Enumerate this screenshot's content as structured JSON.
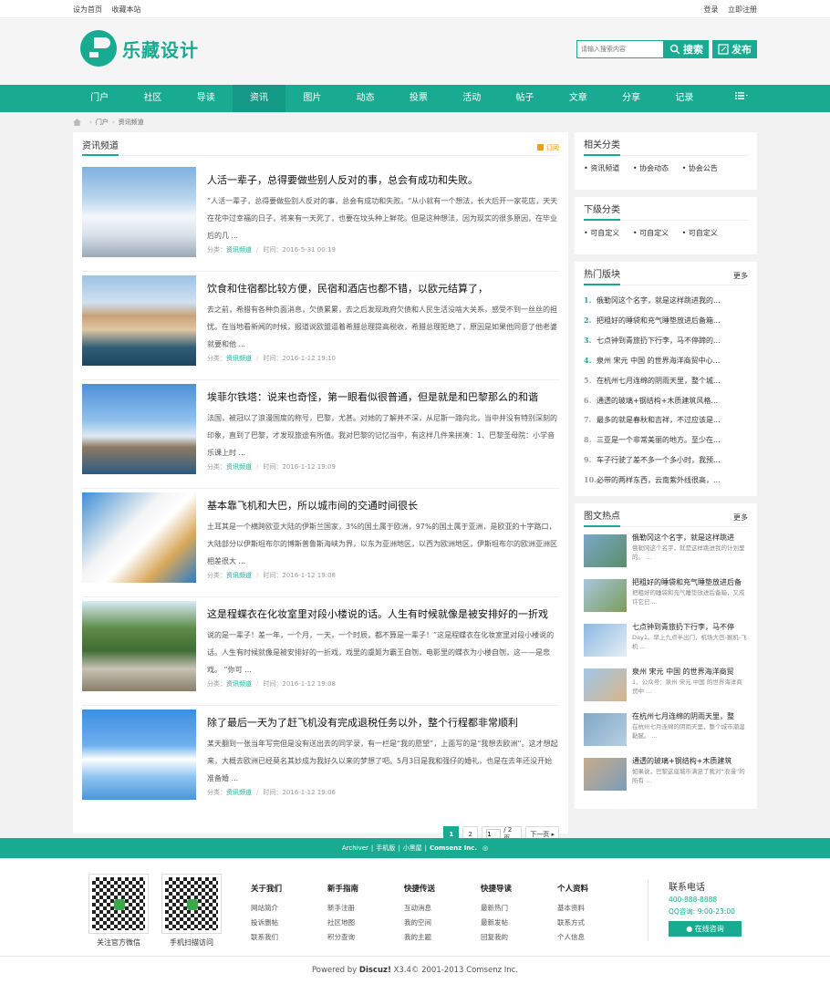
{
  "topbar": {
    "set_home": "设为首页",
    "bookmark": "收藏本站",
    "login": "登录",
    "register": "立即注册"
  },
  "header": {
    "logo_text": "乐藏设计",
    "search_placeholder": "请输入搜索内容",
    "search_button": "搜索",
    "post_button": "发布"
  },
  "nav": {
    "items": [
      "门户",
      "社区",
      "导读",
      "资讯",
      "图片",
      "动态",
      "投票",
      "活动",
      "帖子",
      "文章",
      "分享",
      "记录"
    ],
    "active": "资讯",
    "menu_icon": "list-icon"
  },
  "breadcrumb": {
    "home": "门户",
    "current": "资讯频道"
  },
  "main": {
    "title": "资讯频道",
    "rss": "订阅",
    "category_label": "分类：",
    "time_label": "时间：",
    "articles": [
      {
        "title": "人活一辈子，总得要做些别人反对的事，总会有成功和失败。",
        "summary": "“人活一辈子，总得要做些别人反对的事，总会有成功和失败。“从小就有一个想法，长大后开一家花店，天天在花中过幸福的日子，将来有一天死了，也要在坟头种上鲜花。但是这种想法，因为现实的很多原因，在毕业后的几 ...",
        "category": "资讯频道",
        "time": "2016-5-31 00:19"
      },
      {
        "title": "饮食和住宿都比较方便，民宿和酒店也都不错，以欧元结算了，",
        "summary": "去之前，希腊有各种负面消息，欠债累累，去之后发现政府欠债和人民生活没啥大关系，感受不到一丝丝的担忧。在当地看新闻的时候，报道说欧盟逼着希腊总理提高税收，希腊总理拒绝了，原因是如果他同意了他老婆就要和他 ...",
        "category": "资讯频道",
        "time": "2016-1-12 19:10"
      },
      {
        "title": "埃菲尔铁塔：说来也奇怪，第一眼看似很普通，但是就是和巴黎那么的和谐",
        "summary": "法国，被冠以了浪漫国度的称号，巴黎，尤甚。对她的了解并不深，从尼斯一路向北，当中并没有特别深刻的印象，直到了巴黎，才发现旅途有所值。我对巴黎的记忆当中，有这样几件来拼凑：1、巴黎圣母院：小学音乐课上时 ...",
        "category": "资讯频道",
        "time": "2016-1-12 19:09"
      },
      {
        "title": "基本靠飞机和大巴，所以城市间的交通时间很长",
        "summary": "土耳其是一个横跨欧亚大陆的伊斯兰国家，3%的国土属于欧洲，97%的国土属于亚洲，是欧亚的十字路口，大陆部分以伊斯坦布尔的博斯普鲁斯海峡为界，以东为亚洲地区，以西为欧洲地区，伊斯坦布尔的欧洲亚洲区相差很大 ...",
        "category": "资讯频道",
        "time": "2016-1-12 19:08"
      },
      {
        "title": "这是程蝶衣在化妆室里对段小楼说的话。人生有时候就像是被安排好的一折戏",
        "summary": "说的是一辈子！差一年，一个月，一天，一个时辰，都不算是一辈子！”这是程蝶衣在化妆室里对段小楼说的话。人生有时候就像是被安排好的一折戏，戏里的虞姬为霸王自刎，电影里的蝶衣为小楼自刎，这——是悲戏。 ”你可 ...",
        "category": "资讯频道",
        "time": "2016-1-12 19:08"
      },
      {
        "title": "除了最后一天为了赶飞机没有完成退税任务以外，整个行程都非常顺利",
        "summary": "某天翻到一张当年写完但是没有送出去的同学录，有一栏是“我的愿望”，上面写的是“我想去欧洲”。这才想起来，大概去欧洲已经莫名其妙成为我好久以来的梦想了吧。5月3日是我和强仔的婚礼，也是在去年还没开始准备婚 ...",
        "category": "资讯频道",
        "time": "2016-1-12 19:06"
      }
    ],
    "pager": {
      "pages": [
        "1",
        "2"
      ],
      "current": "1",
      "input_value": "1",
      "total": "/ 2 页",
      "next": "下一页"
    }
  },
  "sidebar": {
    "related": {
      "title": "相关分类",
      "items": [
        "资讯频道",
        "协会动态",
        "协会公告"
      ]
    },
    "sub": {
      "title": "下级分类",
      "items": [
        "可自定义",
        "可自定义",
        "可自定义"
      ]
    },
    "hot_forums": {
      "title": "热门版块",
      "more": "更多",
      "items": [
        {
          "num": "1.",
          "text": "俄勒冈这个名字，就是这样跳进我的..."
        },
        {
          "num": "2.",
          "text": "把粗好的睡袋和充气睡垫放进后备箱..."
        },
        {
          "num": "3.",
          "text": "七点钟到青旅扔下行李，马不停蹄的..."
        },
        {
          "num": "4.",
          "text": "泉州 宋元 中国 的世界海洋商贸中心..."
        },
        {
          "num": "5.",
          "text": "在杭州七月连绵的阴雨天里，整个城..."
        },
        {
          "num": "6.",
          "text": "通透的玻璃+钢结构+木质建筑风格..."
        },
        {
          "num": "7.",
          "text": "最多的就是春秋和吉祥，不过应该是..."
        },
        {
          "num": "8.",
          "text": "三亚是一个非常美丽的地方。至少在..."
        },
        {
          "num": "9.",
          "text": "车子行驶了差不多一个多小时，我预..."
        },
        {
          "num": "10.",
          "text": "必带的两样东西，云南紫外线很高，..."
        }
      ]
    },
    "pic_hot": {
      "title": "图文热点",
      "more": "更多",
      "items": [
        {
          "title": "俄勒冈这个名字，就是这样跳进",
          "desc": "俄勒冈这个名字，就是这样跳进我的计划里的。 ..."
        },
        {
          "title": "把粗好的睡袋和充气睡垫放进后备",
          "desc": "把粗好的睡袋和充气睡垫放进后备箱，又成许它已 ..."
        },
        {
          "title": "七点钟到青旅扔下行李，马不停",
          "desc": "Day1。早上九点半出门，机场大巴-猴机-飞机 ..."
        },
        {
          "title": "泉州 宋元 中国 的世界海洋商贸",
          "desc": "1、公众号：泉州 宋元 中国 的世界海洋商贸中 ..."
        },
        {
          "title": "在杭州七月连绵的阴雨天里，整",
          "desc": "在杭州七月连绵的阴雨天里，整个城市潮湿黏腻。 ..."
        },
        {
          "title": "通透的玻璃+钢结构+木质建筑",
          "desc": "如果说，巴黎这座城市满足了我对“浪漫”的所有 ..."
        }
      ]
    }
  },
  "footbar": {
    "archiver": "Archiver",
    "mobile": "手机版",
    "blackroom": "小黑屋",
    "company": "Comsenz Inc."
  },
  "footer": {
    "qr1_label": "关注官方微信",
    "qr2_label": "手机扫描访问",
    "columns": [
      {
        "title": "关于我们",
        "links": [
          "网站简介",
          "投诉删帖",
          "联系我们"
        ]
      },
      {
        "title": "新手指南",
        "links": [
          "新手注册",
          "社区地图",
          "积分查询"
        ]
      },
      {
        "title": "快捷传送",
        "links": [
          "互动消息",
          "我的空间",
          "我的主题"
        ]
      },
      {
        "title": "快捷导读",
        "links": [
          "最新热门",
          "最新发帖",
          "回复我的"
        ]
      },
      {
        "title": "个人资料",
        "links": [
          "基本资料",
          "联系方式",
          "个人信息"
        ]
      }
    ],
    "contact_title": "联系电话",
    "tel": "400-888-8888",
    "qq": "QQ咨询: 9:00-23:00",
    "consult": "在线咨询"
  },
  "copyright": {
    "powered": "Powered by",
    "brand": "Discuz!",
    "rest": "X3.4© 2001-2013 Comsenz Inc."
  },
  "colors": {
    "accent": "#18ab92",
    "accent_dark": "#139985"
  }
}
